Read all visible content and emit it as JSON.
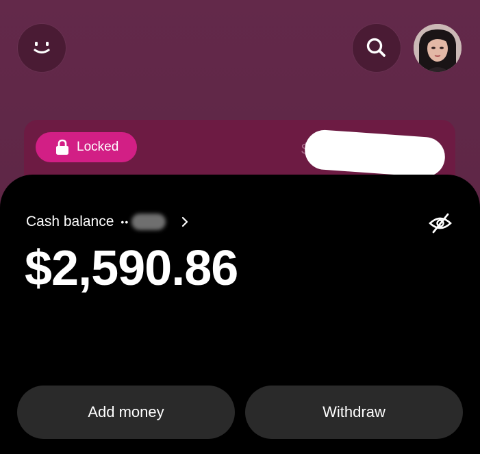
{
  "topbar": {
    "menu_icon": "smiley-icon",
    "search_icon": "search-icon",
    "avatar": "profile-avatar"
  },
  "savings_card": {
    "locked_label": "Locked",
    "lock_icon": "lock-icon",
    "amount_prefix": "$"
  },
  "balance": {
    "label": "Cash balance",
    "account_mask": "••",
    "amount": "$2,590.86",
    "hide_icon": "eye-slash-icon",
    "chevron_icon": "chevron-right-icon"
  },
  "actions": {
    "add_label": "Add money",
    "withdraw_label": "Withdraw"
  },
  "colors": {
    "background": "#5f2846",
    "card": "#6d1b43",
    "pill": "#d21f85",
    "panel": "#000000",
    "button": "#2a2a2a"
  }
}
